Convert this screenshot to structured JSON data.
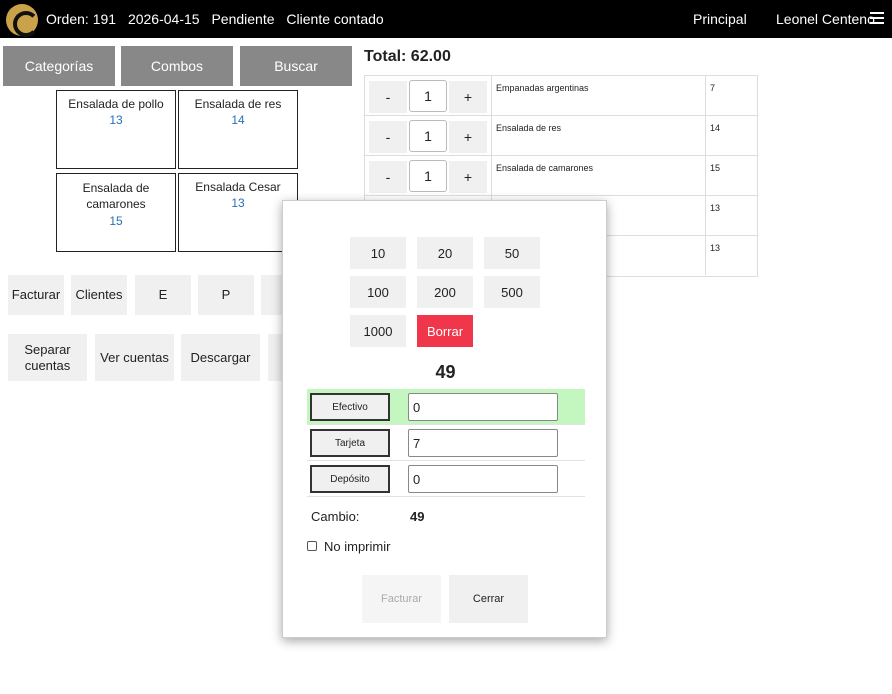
{
  "header": {
    "order": "Orden: 191",
    "date": "2026-04-15",
    "status": "Pendiente",
    "client": "Cliente contado",
    "nav_principal": "Principal",
    "user": "Leonel Centeno"
  },
  "tabs": [
    "Categorías",
    "Combos",
    "Buscar"
  ],
  "products": [
    {
      "name": "Ensalada de pollo",
      "price": "13"
    },
    {
      "name": "Ensalada de res",
      "price": "14"
    },
    {
      "name": "Ensalada de camarones",
      "price": "15"
    },
    {
      "name": "Ensalada Cesar",
      "price": "13"
    }
  ],
  "actions": {
    "facturar": "Facturar",
    "clientes": "Clientes",
    "e": "E",
    "p": "P",
    "separar": "Separar cuentas",
    "ver_cuentas": "Ver cuentas",
    "descargar": "Descargar"
  },
  "order": {
    "total": "Total: 62.00",
    "minus": "-",
    "plus": "+",
    "items": [
      {
        "qty": "1",
        "name": "Empanadas argentinas",
        "price": "7"
      },
      {
        "qty": "1",
        "name": "Ensalada de res",
        "price": "14"
      },
      {
        "qty": "1",
        "name": "Ensalada de camarones",
        "price": "15"
      },
      {
        "qty": "",
        "name": "",
        "price": "13"
      },
      {
        "qty": "",
        "name": "",
        "price": "13"
      }
    ]
  },
  "payment": {
    "quick_amounts": [
      "10",
      "20",
      "50",
      "100",
      "200",
      "500",
      "1000"
    ],
    "delete_label": "Borrar",
    "amount": "49",
    "methods": [
      {
        "label": "Efectivo",
        "value": "0"
      },
      {
        "label": "Tarjeta",
        "value": "7"
      },
      {
        "label": "Depósito",
        "value": "0"
      }
    ],
    "change_label": "Cambio:",
    "change_value": "49",
    "no_print_label": "No imprimir",
    "invoice_label": "Facturar",
    "close_label": "Cerrar"
  },
  "colors": {
    "accent_red": "#f0364a",
    "active_row": "#c4f7c0",
    "price_blue": "#2a6fb8",
    "logo_gold": "#c9a24a"
  }
}
